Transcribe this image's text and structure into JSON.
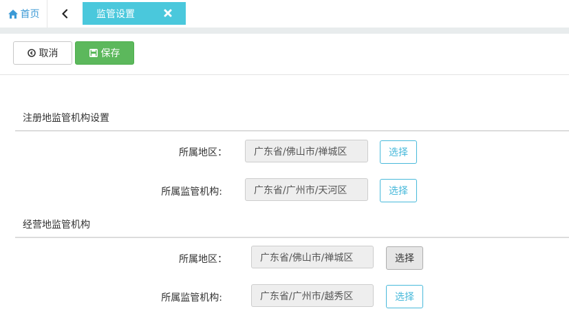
{
  "tabs": {
    "home_label": "首页",
    "active_label": "监管设置"
  },
  "toolbar": {
    "cancel_label": "取消",
    "save_label": "保存"
  },
  "registered": {
    "title": "注册地监管机构设置",
    "region_label": "所属地区：",
    "region_value": "广东省/佛山市/禅城区",
    "region_button": "选择",
    "agency_label": "所属监管机构:",
    "agency_value": "广东省/广州市/天河区",
    "agency_button": "选择"
  },
  "operating": {
    "title": "经营地监管机构",
    "region_label": "所属地区：",
    "region_value": "广东省/佛山市/禅城区",
    "region_button": "选择",
    "agency_label": "所属监管机构:",
    "agency_value": "广东省/广州市/越秀区",
    "agency_button": "选择"
  },
  "colors": {
    "active_tab": "#4ac8dc",
    "save_button": "#5cb85c",
    "choose_button": "#46b8da",
    "home_icon": "#3c9ad6"
  },
  "icons": [
    "home-icon",
    "back-icon",
    "close-icon",
    "cancel-icon",
    "save-icon"
  ]
}
